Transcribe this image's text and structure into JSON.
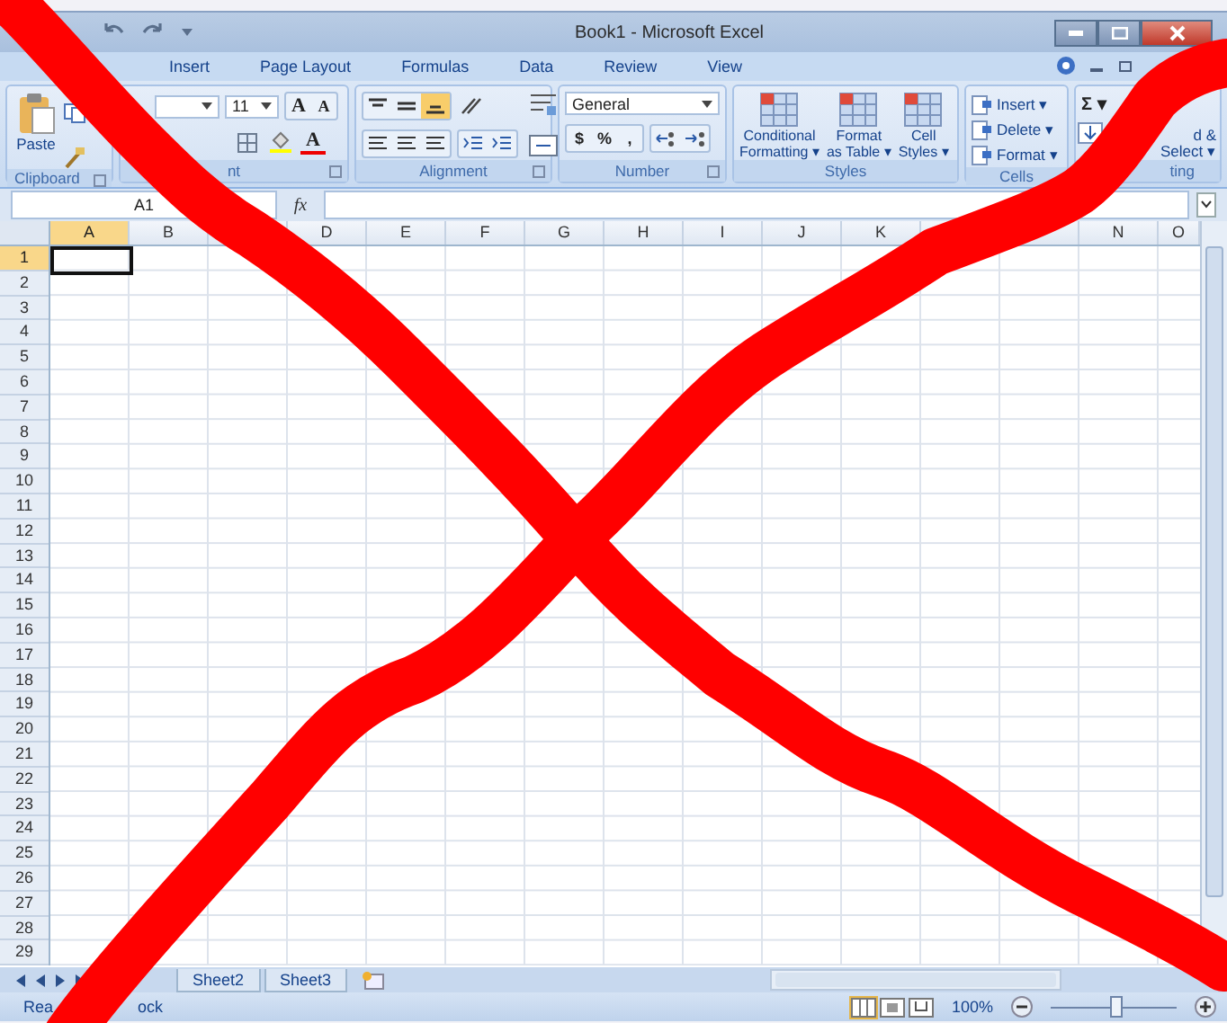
{
  "window": {
    "title": "Book1 - Microsoft Excel"
  },
  "tabs": [
    {
      "label": "Insert",
      "selected": false
    },
    {
      "label": "Page Layout",
      "selected": false
    },
    {
      "label": "Formulas",
      "selected": false
    },
    {
      "label": "Data",
      "selected": false
    },
    {
      "label": "Review",
      "selected": false
    },
    {
      "label": "View",
      "selected": false
    }
  ],
  "clipboard": {
    "paste": "Paste",
    "label": "Clipboard"
  },
  "font": {
    "size": "11",
    "grow": "A",
    "shrink": "A",
    "color_letter": "A",
    "label": "nt"
  },
  "alignment": {
    "label": "Alignment"
  },
  "number": {
    "format": "General",
    "currency": "$",
    "percent": "%",
    "comma": ",",
    "label": "Number"
  },
  "styles": {
    "buttons": [
      {
        "lines": [
          "Conditional",
          "Formatting ▾"
        ]
      },
      {
        "lines": [
          "Format",
          "as Table ▾"
        ]
      },
      {
        "lines": [
          "Cell",
          "Styles ▾"
        ]
      }
    ],
    "label": "Styles"
  },
  "cells": {
    "buttons": [
      "Insert ▾",
      "Delete ▾",
      "Format ▾"
    ],
    "label": "Cells"
  },
  "editing": {
    "sum": "Σ ▾",
    "find_lines": [
      "d &",
      "Select ▾"
    ],
    "label": "ting"
  },
  "formula_bar": {
    "name_box": "A1",
    "fx": "fx"
  },
  "columns": [
    {
      "label": "A",
      "selected": true
    },
    {
      "label": "B",
      "selected": false
    },
    {},
    {
      "label": "D",
      "selected": false
    },
    {
      "label": "E",
      "selected": false
    },
    {
      "label": "F",
      "selected": false
    },
    {
      "label": "G",
      "selected": false
    },
    {
      "label": "H",
      "selected": false
    },
    {
      "label": "I",
      "selected": false
    },
    {
      "label": "J",
      "selected": false
    },
    {
      "label": "K",
      "selected": false
    },
    {},
    {},
    {
      "label": "N",
      "selected": false
    },
    {
      "label": "O",
      "selected": false
    }
  ],
  "rows": [
    {
      "label": "1",
      "selected": true
    },
    {
      "label": "2",
      "selected": false
    },
    {
      "label": "3",
      "selected": false
    },
    {
      "label": "4",
      "selected": false
    },
    {
      "label": "5",
      "selected": false
    },
    {
      "label": "6",
      "selected": false
    },
    {
      "label": "7",
      "selected": false
    },
    {
      "label": "8",
      "selected": false
    },
    {
      "label": "9",
      "selected": false
    },
    {
      "label": "10",
      "selected": false
    },
    {
      "label": "11",
      "selected": false
    },
    {
      "label": "12",
      "selected": false
    },
    {
      "label": "13",
      "selected": false
    },
    {
      "label": "14",
      "selected": false
    },
    {
      "label": "15",
      "selected": false
    },
    {
      "label": "16",
      "selected": false
    },
    {
      "label": "17",
      "selected": false
    },
    {
      "label": "18",
      "selected": false
    },
    {
      "label": "19",
      "selected": false
    },
    {
      "label": "20",
      "selected": false
    },
    {
      "label": "21",
      "selected": false
    },
    {
      "label": "22",
      "selected": false
    },
    {
      "label": "23",
      "selected": false
    },
    {
      "label": "24",
      "selected": false
    },
    {
      "label": "25",
      "selected": false
    },
    {
      "label": "26",
      "selected": false
    },
    {
      "label": "27",
      "selected": false
    },
    {
      "label": "28",
      "selected": false
    },
    {
      "label": "29",
      "selected": false
    }
  ],
  "sheet_tabs": [
    {
      "label": "Sheet2",
      "selected": false
    },
    {
      "label": "Sheet3",
      "selected": false
    }
  ],
  "status_bar": {
    "left": [
      "Rea",
      "ock"
    ],
    "zoom": "100%",
    "zoom_slider": {
      "level": 0.5
    }
  }
}
